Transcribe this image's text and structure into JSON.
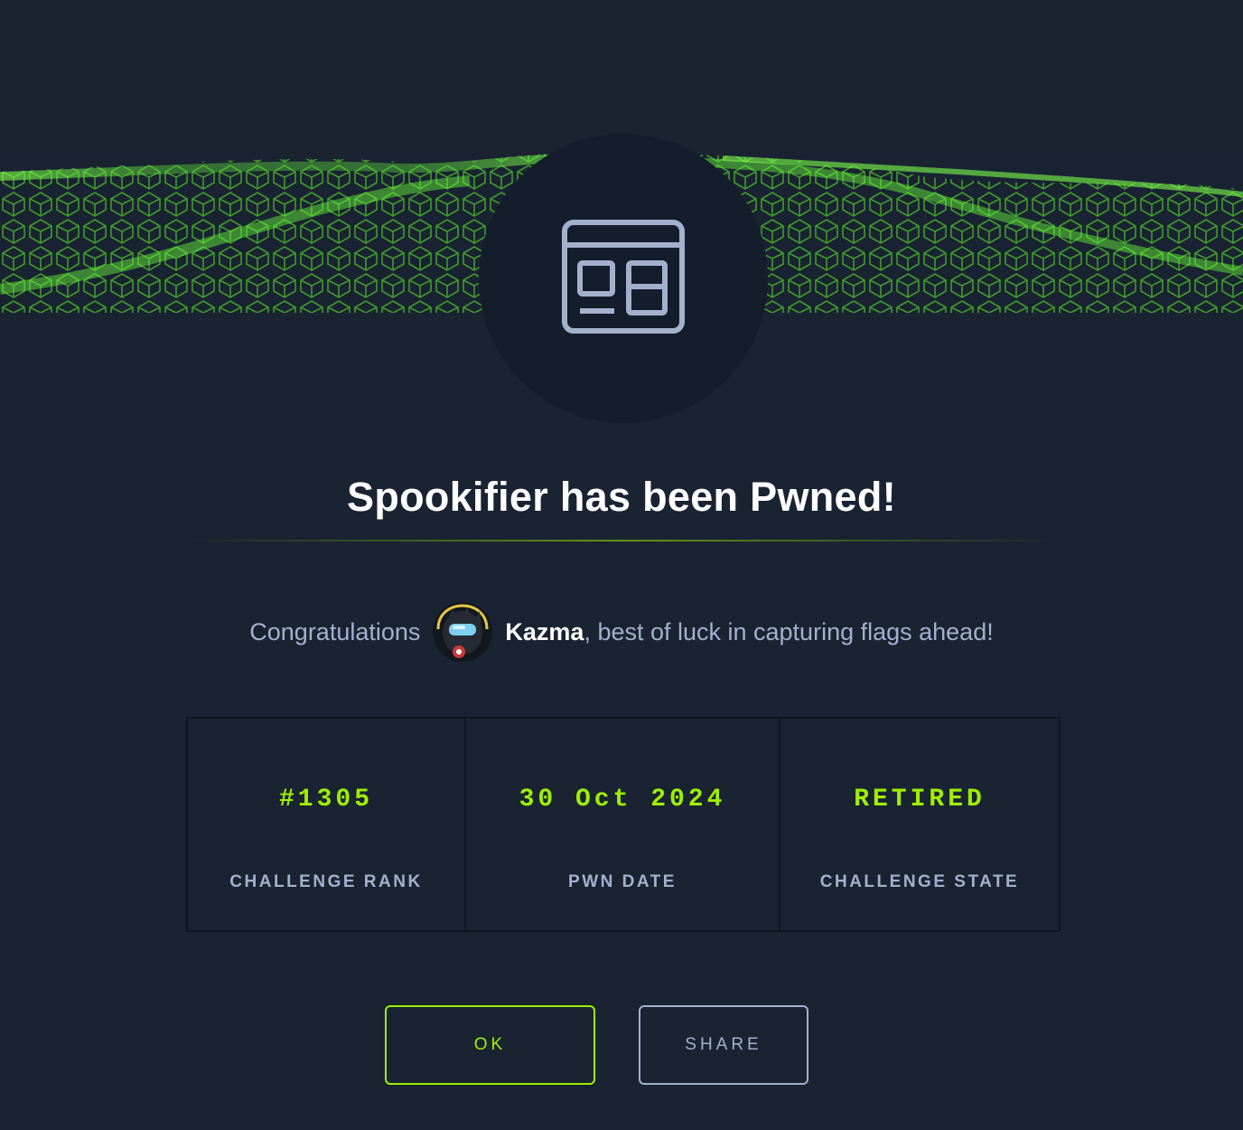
{
  "modal": {
    "title": "Spookifier has been Pwned!",
    "icon": "web-browser-window-icon",
    "banner": "green-cube-wave-graphic"
  },
  "congrats": {
    "prefix": "Congratulations",
    "username": "Kazma",
    "suffix": ", best of luck in capturing flags ahead!",
    "avatar": "user-avatar"
  },
  "stats": [
    {
      "value": "#1305",
      "label": "CHALLENGE RANK"
    },
    {
      "value": "30 Oct 2024",
      "label": "PWN DATE"
    },
    {
      "value": "RETIRED",
      "label": "CHALLENGE STATE"
    }
  ],
  "buttons": {
    "ok": "OK",
    "share": "SHARE"
  },
  "colors": {
    "background": "#1a2332",
    "accent": "#9fef00",
    "muted_text": "#a4b1cd",
    "circle": "#141d2b"
  }
}
